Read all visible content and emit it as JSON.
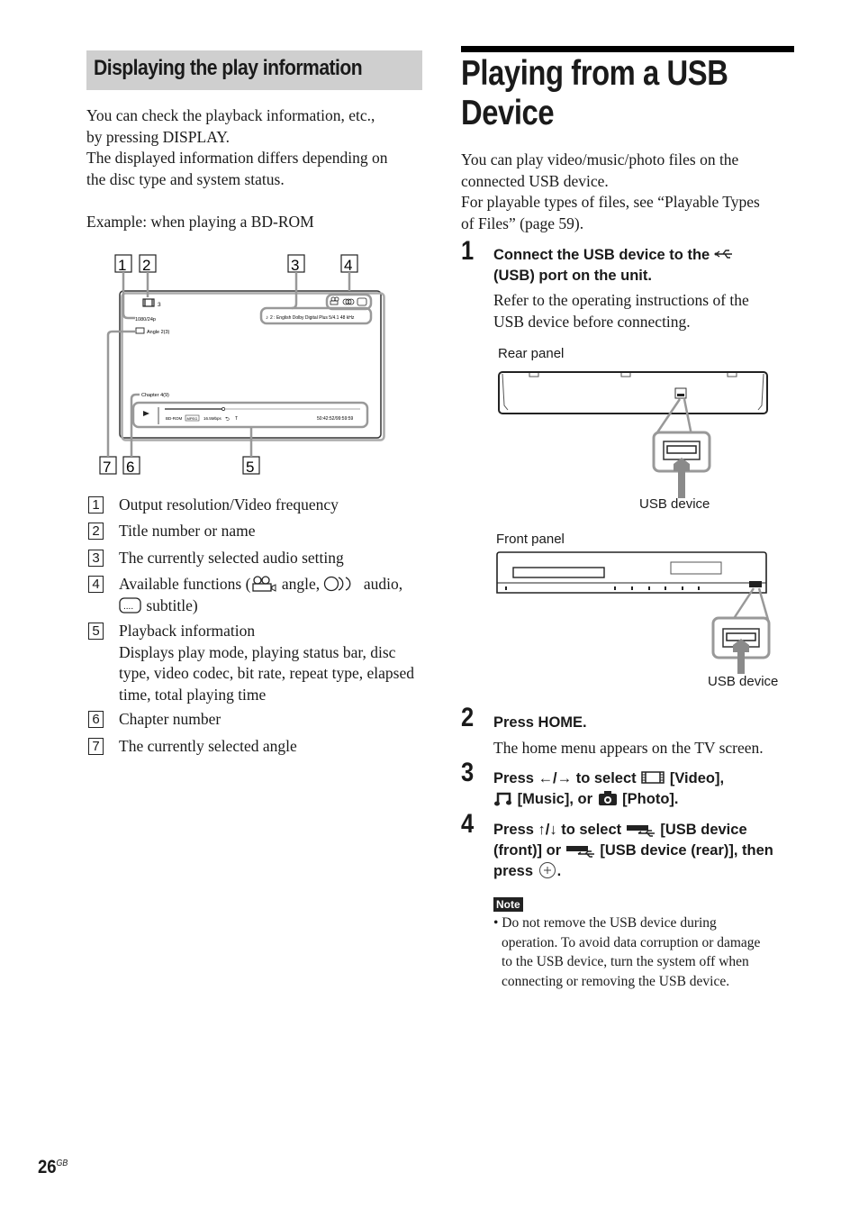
{
  "left_section": {
    "heading": "Displaying the play information",
    "intro_lines": [
      "You can check the playback information, etc.,",
      "by pressing DISPLAY.",
      "The displayed information differs depending on",
      "the disc type and system status."
    ],
    "example": "Example: when playing a BD-ROM",
    "diagram": {
      "callouts": [
        "1",
        "2",
        "3",
        "4",
        "5",
        "6",
        "7"
      ],
      "title_number": "3",
      "resolution": "1080/24p",
      "angle": "Angle  2(3)",
      "audio": "2 : English  Dolby Digital Plus  5/4.1 48 kHz",
      "chapter": "Chapter 4(9)",
      "disc_type": "BD-ROM",
      "codec": "MPEG",
      "bitrate": "16.5Mbps",
      "repeat": "T",
      "time": "50:42:52/99:59:59",
      "playback_progress_fraction": 0.3,
      "icons": [
        "film-icon",
        "angle-camera-icon",
        "audio-circles-icon",
        "subtitle-icon",
        "play-icon",
        "repeat-icon",
        "music-note-icon"
      ]
    },
    "legend": [
      {
        "num": "1",
        "text": "Output resolution/Video frequency"
      },
      {
        "num": "2",
        "text": "Title number or name"
      },
      {
        "num": "3",
        "text": "The currently selected audio setting"
      },
      {
        "num": "4",
        "text_a": "Available functions (",
        "text_b": " angle, ",
        "text_c": " audio,",
        "text_d": " subtitle)"
      },
      {
        "num": "5",
        "text": "Playback information",
        "detail_lines": [
          "Displays play mode, playing status bar, disc",
          "type, video codec, bit rate, repeat type, elapsed",
          "time, total playing time"
        ]
      },
      {
        "num": "6",
        "text": "Chapter number"
      },
      {
        "num": "7",
        "text": "The currently selected angle"
      }
    ]
  },
  "right_section": {
    "title_line1": "Playing from a USB",
    "title_line2": "Device",
    "intro_lines": [
      "You can play video/music/photo files on the",
      "connected USB device.",
      "For playable types of files, see “Playable Types",
      "of Files” (page 59)."
    ],
    "steps": [
      {
        "num": "1",
        "title_a": "Connect the USB device to the ",
        "title_b": "(USB) port on the unit.",
        "body_lines": [
          "Refer to the operating instructions of the",
          "USB device before connecting."
        ]
      },
      {
        "num": "2",
        "title": "Press HOME.",
        "body": "The home menu appears on the TV screen."
      },
      {
        "num": "3",
        "title_a": "Press ←/→ to select ",
        "title_b": " [Video],",
        "title_c": " [Music], or ",
        "title_d": " [Photo]."
      },
      {
        "num": "4",
        "title_a": "Press ↑/↓ to select ",
        "title_b": " [USB device",
        "title_c": "(front)] or ",
        "title_d": " [USB device (rear)], then",
        "title_e": "press ",
        "title_f": "."
      }
    ],
    "rear_panel_label": "Rear panel",
    "front_panel_label": "Front panel",
    "usb_device_label": "USB device",
    "note_badge": "Note",
    "note_lines": [
      "• Do not remove the USB device during",
      "operation. To avoid data corruption or damage",
      "to the USB device, turn the system off when",
      "connecting or removing the USB device."
    ]
  },
  "footer": {
    "page_number": "26",
    "page_suffix": "GB"
  }
}
